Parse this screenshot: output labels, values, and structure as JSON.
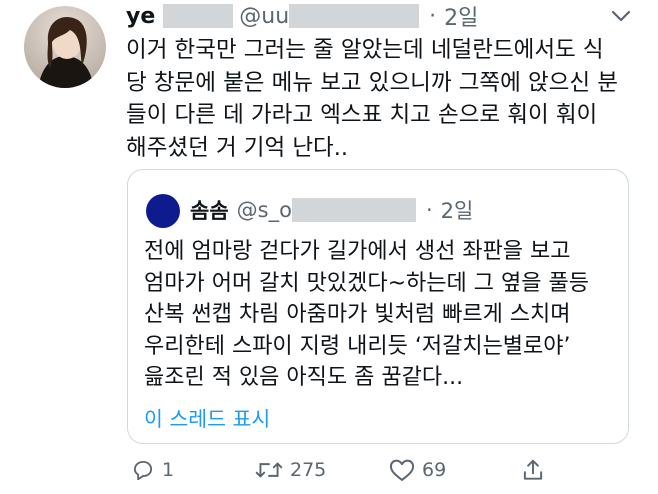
{
  "tweet": {
    "name_visible": "ye",
    "handle_visible": "@uu",
    "separator": "·",
    "time": "2일",
    "text": "이거 한국만 그러는 줄 알았는데 네덜란드에서도 식\n당 창문에 붙은 메뉴 보고 있으니까 그쪽에 앉으신 분\n들이 다른 데 가라고 엑스표 치고 손으로 훠이 훠이\n해주셨던 거 기억 난다..",
    "avatar_icon": "user-photo",
    "more_icon": "chevron-down-icon"
  },
  "quote": {
    "name": "솜솜",
    "handle_visible": "@s_o",
    "separator": "·",
    "time": "2일",
    "text": "전에 엄마랑 걷다가 길가에서 생선 좌판을 보고\n엄마가 어머 갈치 맛있겠다~하는데 그 옆을 풀등\n산복 썬캡 차림 아줌마가 빛처럼 빠르게 스치며\n우리한테 스파이 지령 내리듯 ‘저갈치는별로야’\n읊조린 적 있음 아직도 좀 꿈같다...",
    "show_thread": "이 스레드 표시",
    "avatar_color": "#0e1b8f"
  },
  "actions": {
    "reply_count": "1",
    "retweet_count": "275",
    "like_count": "69"
  },
  "colors": {
    "text": "#0f1419",
    "secondary": "#5b6670",
    "link": "#1d9bf0",
    "border": "#cfd9de",
    "redaction": "#d3d6d9"
  }
}
